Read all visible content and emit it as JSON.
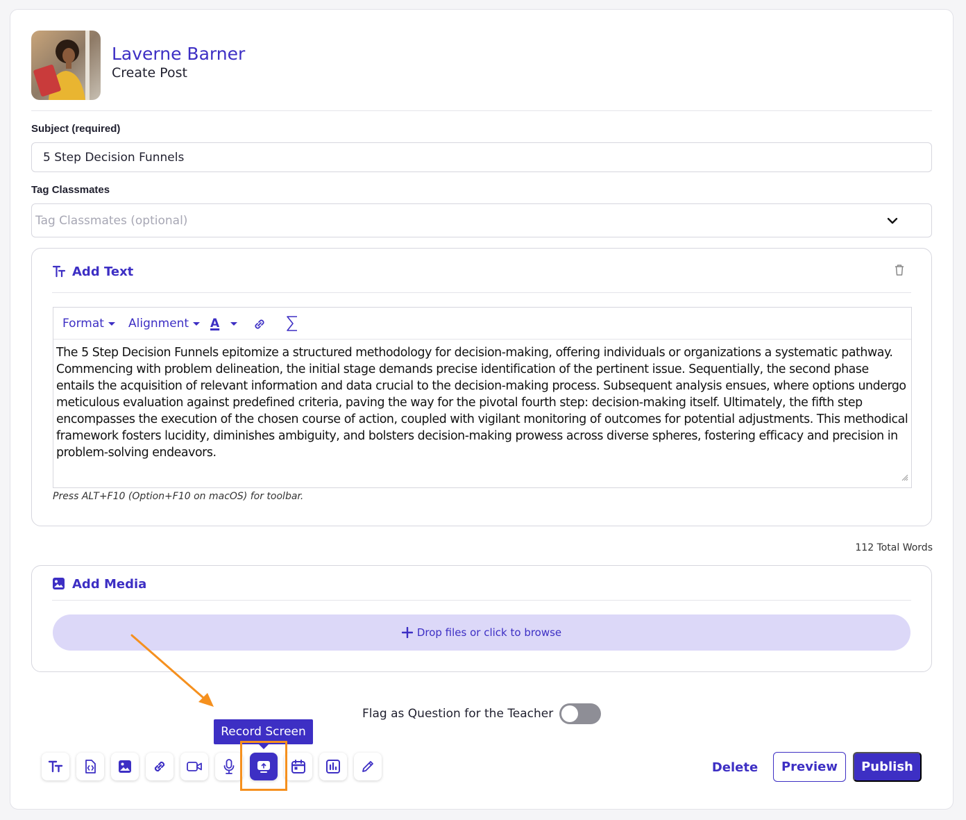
{
  "header": {
    "user_name": "Laverne Barner",
    "mode": "Create Post"
  },
  "subject": {
    "label": "Subject (required)",
    "value": "5 Step Decision Funnels"
  },
  "tags": {
    "label": "Tag Classmates",
    "placeholder": "Tag Classmates (optional)"
  },
  "text_block": {
    "title": "Add Text",
    "toolbar": {
      "format": "Format",
      "alignment": "Alignment",
      "text_color_glyph": "A"
    },
    "content": "The 5 Step Decision Funnels epitomize a structured methodology for decision-making, offering individuals or organizations a systematic pathway. Commencing with problem delineation, the initial stage demands precise identification of the pertinent issue. Sequentially, the second phase entails the acquisition of relevant information and data crucial to the decision-making process. Subsequent analysis ensues, where options undergo meticulous evaluation against predefined criteria, paving the way for the pivotal fourth step: decision-making itself. Ultimately, the fifth step encompasses the execution of the chosen course of action, coupled with vigilant monitoring of outcomes for potential adjustments. This methodical framework fosters lucidity, diminishes ambiguity, and bolsters decision-making prowess across diverse spheres, fostering efficacy and precision in problem-solving endeavors.",
    "hint": "Press ALT+F10 (Option+F10 on macOS) for toolbar."
  },
  "word_count": "112 Total Words",
  "media_block": {
    "title": "Add Media",
    "dropzone": "Drop files or click to browse"
  },
  "flag": {
    "label": "Flag as Question for the Teacher",
    "on": false
  },
  "tooltip": "Record Screen",
  "tools": [
    "text-icon",
    "embed-code-icon",
    "image-icon",
    "link-icon",
    "video-icon",
    "microphone-icon",
    "record-screen-icon",
    "calendar-icon",
    "poll-icon",
    "pen-icon"
  ],
  "actions": {
    "delete": "Delete",
    "preview": "Preview",
    "publish": "Publish"
  },
  "colors": {
    "accent": "#3d2fc4",
    "dropzone": "#dcd8f8",
    "highlight": "#f5901e"
  }
}
